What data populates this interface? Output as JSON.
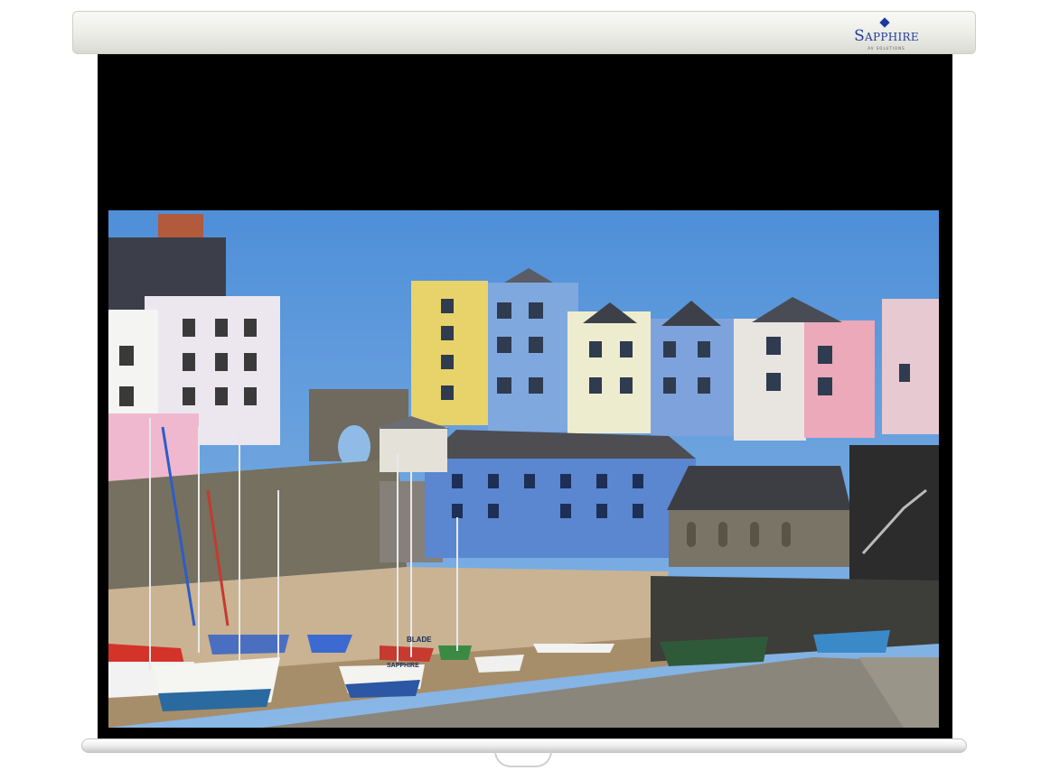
{
  "brand": {
    "name": "Sapphire",
    "tagline": "AV SOLUTIONS"
  },
  "photo": {
    "boat_labels": [
      "BLADE",
      "SAPPHIRE"
    ]
  },
  "colors": {
    "screen_border": "#000000",
    "housing": "#efefea",
    "brand_blue": "#1f3c9a",
    "sky": "#5a94d6"
  }
}
